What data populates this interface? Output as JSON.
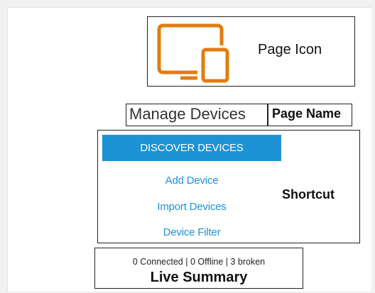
{
  "page_icon": {
    "icon": "devices-icon",
    "icon_color": "#e07d10",
    "callout": "Page Icon"
  },
  "page_name": {
    "title": "Manage Devices",
    "callout": "Page Name"
  },
  "shortcut": {
    "primary_button": "DISCOVER DEVICES",
    "links": [
      "Add Device",
      "Import Devices",
      "Device Filter"
    ],
    "accent_color": "#1b93d5",
    "callout": "Shortcut"
  },
  "live_summary": {
    "status_text": "0 Connected | 0 Offline | 3 broken",
    "callout": "Live Summary"
  }
}
